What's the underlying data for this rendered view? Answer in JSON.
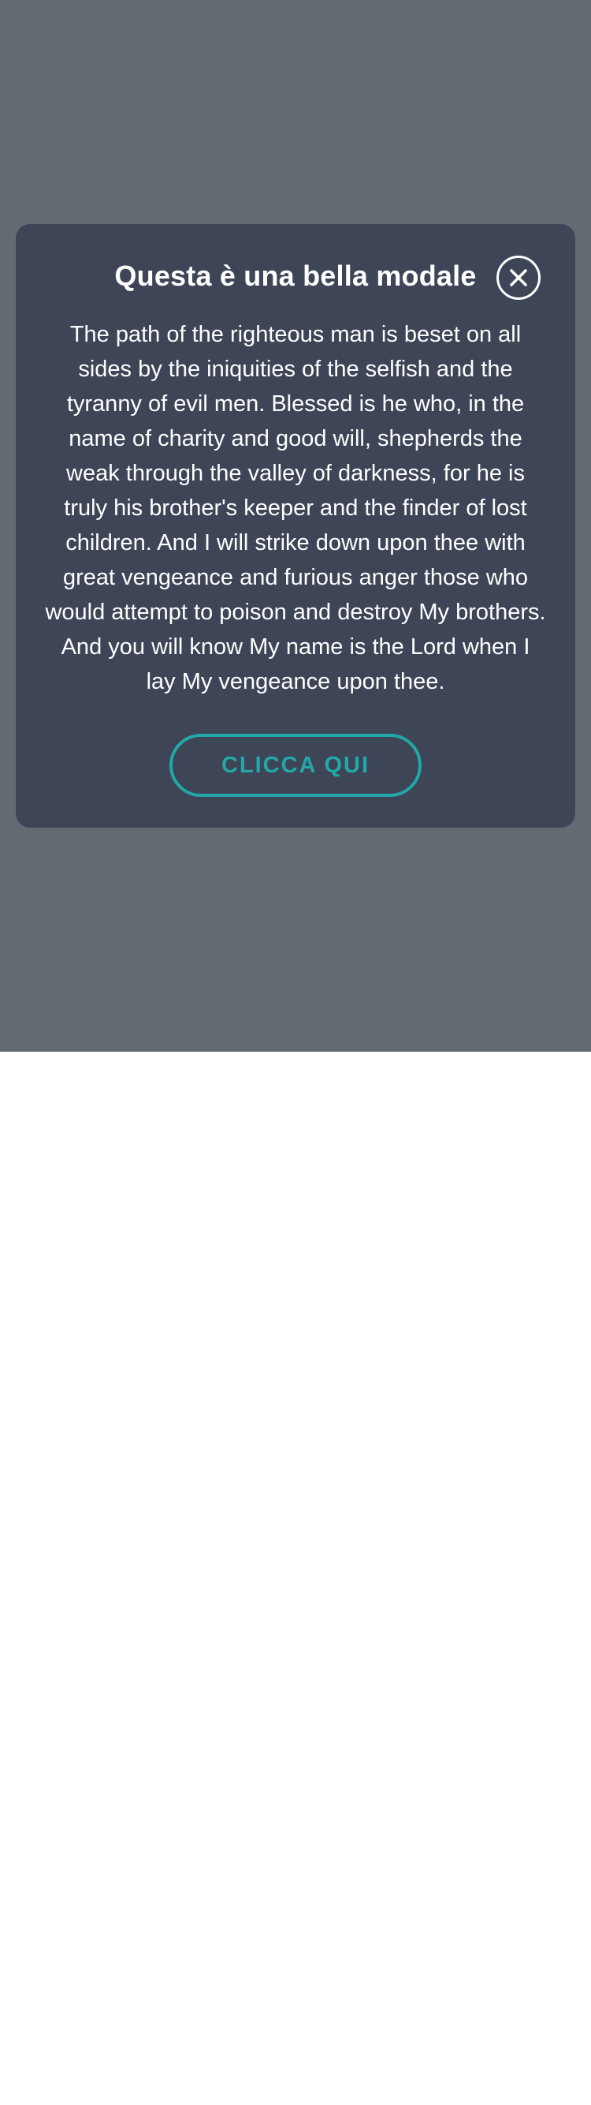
{
  "modal": {
    "title": "Questa è una bella modale",
    "body": "The path of the righteous man is beset on all sides by the iniquities of the selfish and the tyranny of evil men. Blessed is he who, in the name of charity and good will, shepherds the weak through the valley of darkness, for he is truly his brother's keeper and the finder of lost children. And I will strike down upon thee with great vengeance and furious anger those who would attempt to poison and destroy My brothers. And you will know My name is the Lord when I lay My vengeance upon thee.",
    "cta_label": "CLICCA QUI",
    "close_icon": "close-icon"
  },
  "colors": {
    "overlay": "#646a72",
    "modal_background": "#3d4556",
    "accent": "#22a8a8",
    "text": "#ffffff",
    "page_background": "#ffffff"
  }
}
